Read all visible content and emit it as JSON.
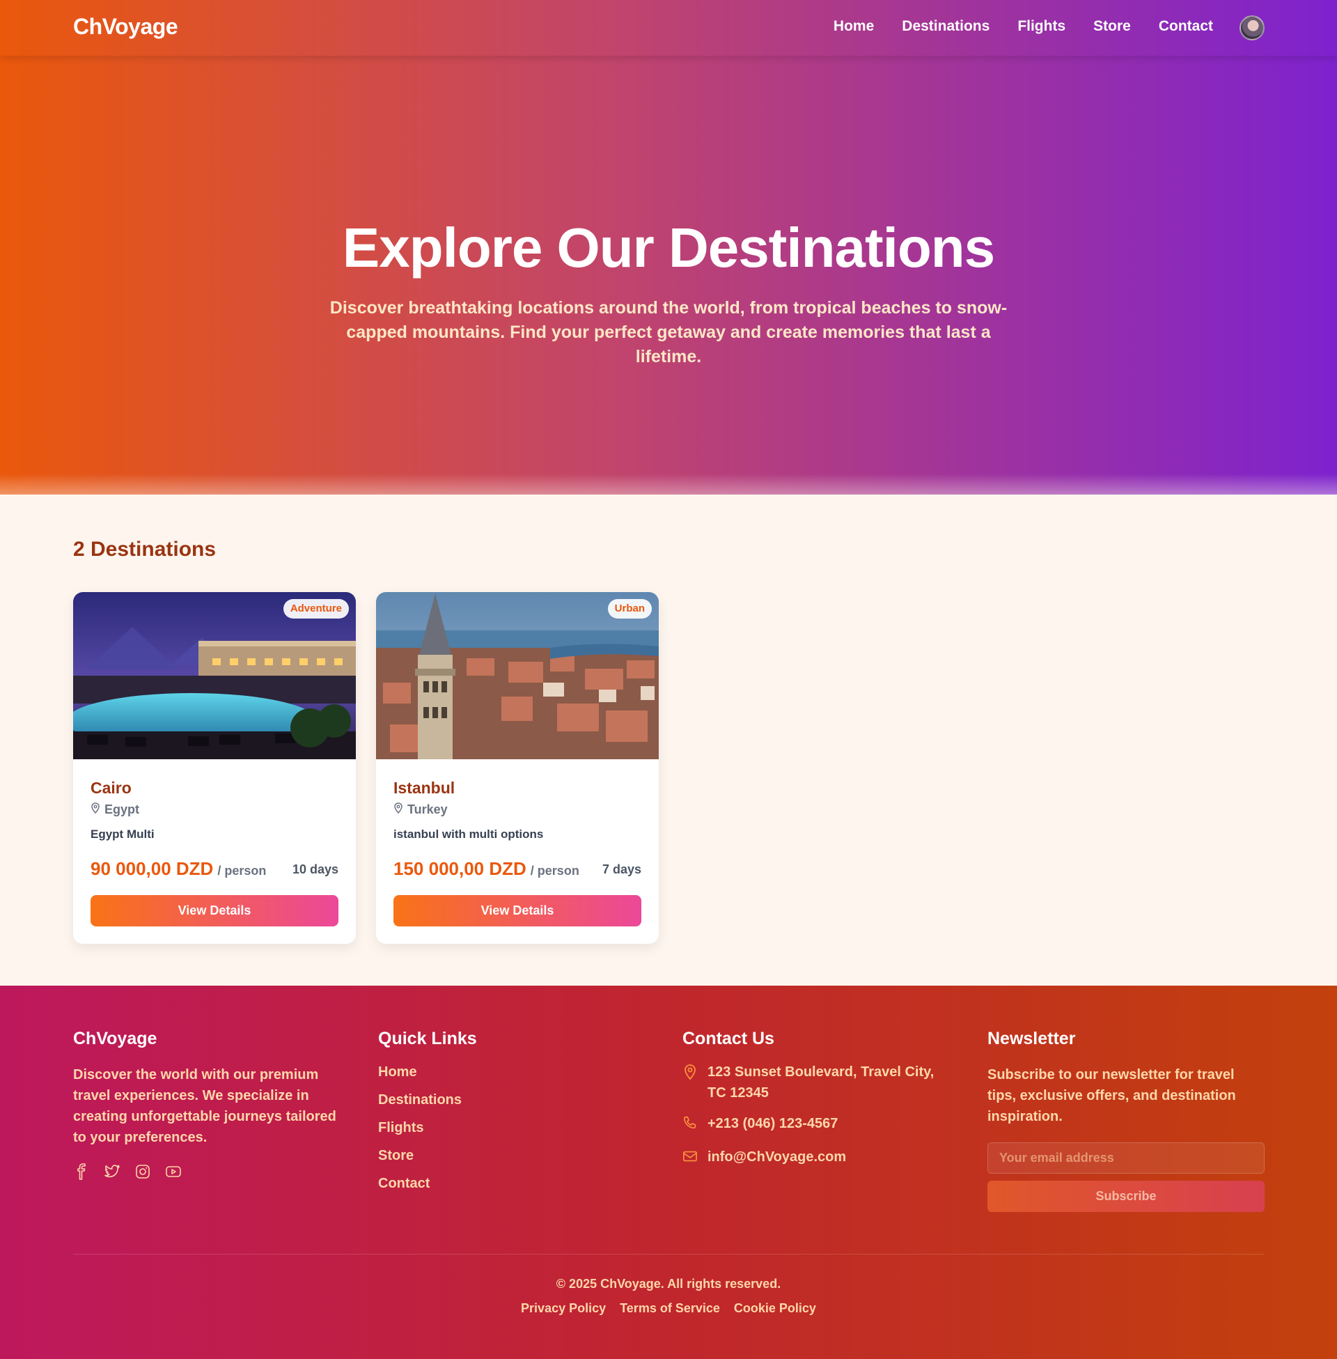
{
  "nav": {
    "brand": "ChVoyage",
    "links": [
      "Home",
      "Destinations",
      "Flights",
      "Store",
      "Contact"
    ]
  },
  "hero": {
    "title": "Explore Our Destinations",
    "subtitle": "Discover breathtaking locations around the world, from tropical beaches to snow-capped mountains. Find your perfect getaway and create memories that last a lifetime."
  },
  "listing": {
    "count_label": "2 Destinations",
    "cards": [
      {
        "badge": "Adventure",
        "name": "Cairo",
        "country": "Egypt",
        "description": "Egypt Multi",
        "price": "90 000,00 DZD",
        "price_unit": "/ person",
        "duration": "10 days",
        "button": "View Details"
      },
      {
        "badge": "Urban",
        "name": "Istanbul",
        "country": "Turkey",
        "description": "istanbul with multi options",
        "price": "150 000,00 DZD",
        "price_unit": "/ person",
        "duration": "7 days",
        "button": "View Details"
      }
    ]
  },
  "footer": {
    "about": {
      "title": "ChVoyage",
      "text": "Discover the world with our premium travel experiences. We specialize in creating unforgettable journeys tailored to your preferences.",
      "social_icons": [
        "facebook-icon",
        "twitter-icon",
        "instagram-icon",
        "youtube-icon"
      ]
    },
    "quick_links": {
      "title": "Quick Links",
      "items": [
        "Home",
        "Destinations",
        "Flights",
        "Store",
        "Contact"
      ]
    },
    "contact": {
      "title": "Contact Us",
      "address": "123 Sunset Boulevard, Travel City, TC 12345",
      "phone": "+213 (046) 123-4567",
      "email": "info@ChVoyage.com"
    },
    "newsletter": {
      "title": "Newsletter",
      "text": "Subscribe to our newsletter for travel tips, exclusive offers, and destination inspiration.",
      "placeholder": "Your email address",
      "button": "Subscribe"
    },
    "copyright": "© 2025 ChVoyage. All rights reserved.",
    "legal": [
      "Privacy Policy",
      "Terms of Service",
      "Cookie Policy"
    ]
  },
  "colors": {
    "brand_orange": "#ea580c",
    "brand_purple": "#7e22ce",
    "heading_brown": "#9a3412",
    "footer_red": "#c0262d",
    "footer_text": "#fed7aa"
  }
}
